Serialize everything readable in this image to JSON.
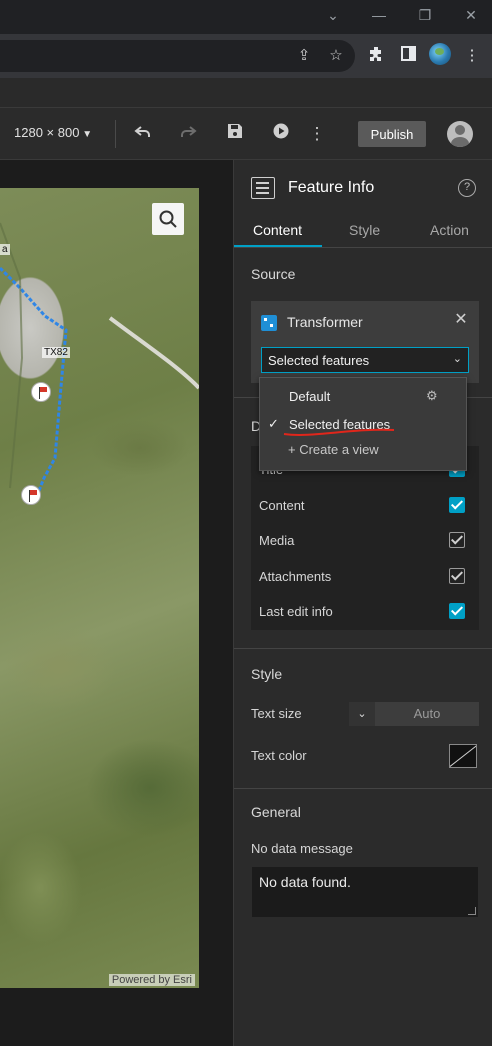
{
  "browser": {
    "window_controls": [
      "chevron",
      "minimize",
      "maximize",
      "close"
    ],
    "toolbar_icons": [
      "share-icon",
      "star-icon",
      "extensions-icon",
      "sidebar-icon",
      "profile-icon",
      "more-icon"
    ]
  },
  "toolbar": {
    "resolution": "1280 × 800",
    "publish_label": "Publish"
  },
  "map": {
    "road_label": "TX82",
    "edge_label": "a",
    "attribution": "Powered by Esri"
  },
  "panel": {
    "title": "Feature Info",
    "help": "?",
    "tabs": [
      "Content",
      "Style",
      "Action"
    ],
    "active_tab": "Content",
    "source": {
      "section_title": "Source",
      "data_source_name": "Transformer",
      "selected_view": "Selected features"
    },
    "dropdown": {
      "items": [
        {
          "label": "Default",
          "checked": false
        },
        {
          "label": "Selected features",
          "checked": true
        }
      ],
      "create_label": "+ Create a view"
    },
    "display": {
      "section_title": "D",
      "options": [
        {
          "label": "Title",
          "checked": true,
          "style": "accent"
        },
        {
          "label": "Content",
          "checked": true,
          "style": "accent"
        },
        {
          "label": "Media",
          "checked": true,
          "style": "grey"
        },
        {
          "label": "Attachments",
          "checked": true,
          "style": "grey"
        },
        {
          "label": "Last edit info",
          "checked": true,
          "style": "accent"
        }
      ]
    },
    "style": {
      "section_title": "Style",
      "text_size_label": "Text size",
      "text_size_value": "Auto",
      "text_color_label": "Text color"
    },
    "general": {
      "section_title": "General",
      "no_data_label": "No data message",
      "no_data_value": "No data found."
    }
  },
  "colors": {
    "accent": "#00a0c6",
    "panel_bg": "#2b2b2b",
    "annotation": "#e0261b"
  }
}
